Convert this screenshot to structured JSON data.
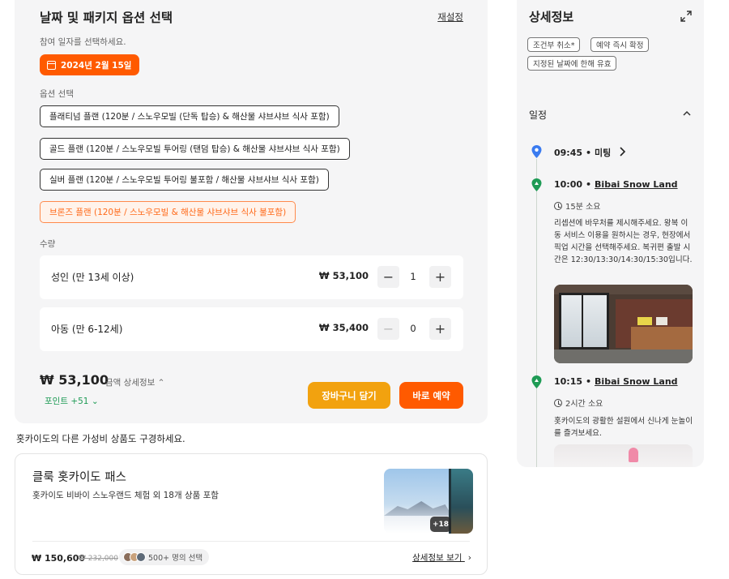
{
  "options_panel": {
    "title": "날짜 및 패키지 옵션 선택",
    "reset_label": "재설정",
    "date_label": "참여 일자를 선택하세요.",
    "selected_date": "2024년 2월 15일",
    "option_label": "옵션 선택",
    "options": [
      {
        "label": "플래티넘 플랜 (120분 / 스노우모빌 (단독 탑승) & 해산물 샤브샤브 식사 포함)",
        "state": "available"
      },
      {
        "label": "골드 플랜 (120분 / 스노우모빌 투어링 (탠덤 탑승) & 해산물 샤브샤브 식사 포함)",
        "state": "available"
      },
      {
        "label": "실버 플랜 (120분 / 스노우모빌 투어링 불포함 / 해산물 샤브샤브 식사 포함)",
        "state": "available"
      },
      {
        "label": "브론즈 플랜 (120분 / 스노우모빌 & 해산물 샤브샤브 식사 불포함)",
        "state": "highlighted"
      }
    ],
    "quantity_label": "수량",
    "quantities": [
      {
        "label": "성인 (만 13세 이상)",
        "price": "₩ 53,100",
        "count": "1",
        "decrement_enabled": true
      },
      {
        "label": "아동 (만 6-12세)",
        "price": "₩ 35,400",
        "count": "0",
        "decrement_enabled": false
      }
    ],
    "total_price": "₩ 53,100",
    "total_detail_link": "금액 상세정보 ⌃",
    "points": "포인트 +51 ⌄",
    "cart_button": "장바구니 담기",
    "book_button": "바로 예약"
  },
  "other_products": {
    "heading": "홋카이도의 다른 가성비 상품도 구경하세요.",
    "card": {
      "title": "클룩 홋카이도 패스",
      "subtitle": "홋카이도 비바이 스노우랜드 체험 외 18개 상품 포함",
      "thumb_badge": "+18",
      "price": "₩ 150,600",
      "original_price": "₩ 232,000",
      "chosen": "500+ 명의 선택",
      "detail_link": "상세정보 보기"
    }
  },
  "detail_panel": {
    "title": "상세정보",
    "tags": [
      "조건부 취소*",
      "예약 즉시 확정",
      "지정된 날짜에 한해 유효"
    ],
    "schedule_label": "일정",
    "timeline": [
      {
        "time": "09:45",
        "place": "미팅"
      },
      {
        "time": "10:00",
        "place": "Bibai Snow Land",
        "duration": "15분 소요",
        "description": "리셉션에 바우처를 제시해주세요. 왕복 이동 서비스 이용을 원하시는 경우, 현장에서 픽업 시간을 선택해주세요. 복귀편 출발 시간은 12:30/13:30/14:30/15:30입니다."
      },
      {
        "time": "10:15",
        "place": "Bibai Snow Land",
        "duration": "2시간 소요",
        "description": "홋카이도의 광활한 설원에서 신나게 눈놀이를 즐겨보세요."
      }
    ]
  },
  "colors": {
    "accent": "#ff5a00",
    "cart": "#f2a20f",
    "point_green": "#1e9b55",
    "pin_blue": "#3a7bf0",
    "pin_green": "#1e9b55"
  }
}
